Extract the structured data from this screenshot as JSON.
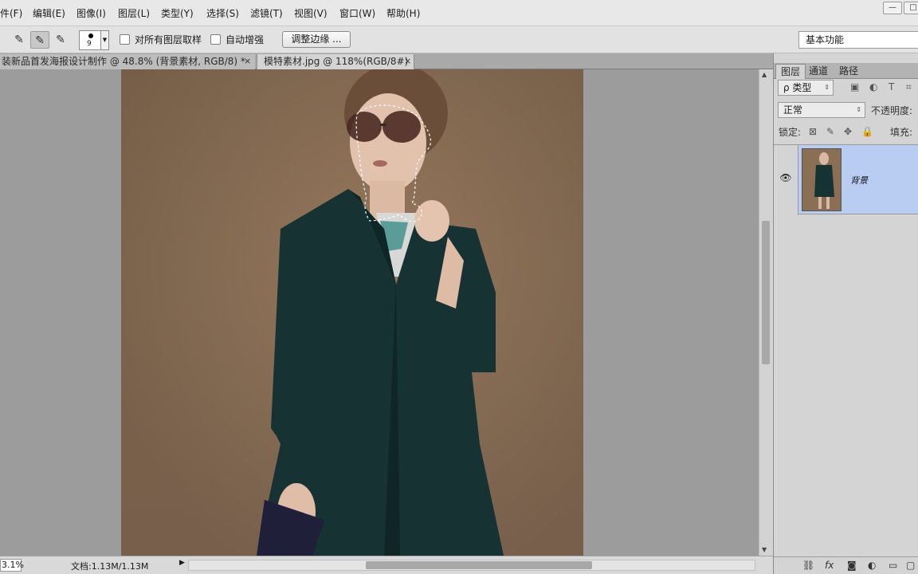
{
  "menu": [
    "件(F)",
    "编辑(E)",
    "图像(I)",
    "图层(L)",
    "类型(Y)",
    "选择(S)",
    "滤镜(T)",
    "视图(V)",
    "窗口(W)",
    "帮助(H)"
  ],
  "window_controls": {
    "minimize": "—",
    "restore": "□",
    "close": "✕"
  },
  "options": {
    "brush_size": "9",
    "sample_all_layers": "对所有图层取样",
    "auto_enhance": "自动增强",
    "refine_edge": "调整边缘 ...",
    "workspace": "基本功能"
  },
  "doc_tabs": [
    {
      "title": "装新品首发海报设计制作 @ 48.8% (背景素材, RGB/8) *",
      "close": "×"
    },
    {
      "title": "模特素材.jpg @ 118%(RGB/8#)",
      "close": "×"
    }
  ],
  "status": {
    "zoom": "3.1%",
    "doc_size": "文档:1.13M/1.13M"
  },
  "layers_panel": {
    "tabs": [
      "图层",
      "通道",
      "路径"
    ],
    "filter_kind": "ρ 类型",
    "blend_mode": "正常",
    "opacity_label": "不透明度:",
    "lock_label": "锁定:",
    "fill_label": "填充:",
    "layer_name": "背景"
  },
  "colors": {
    "accent_selection": "#b9cdf2",
    "backdrop": "#8a6f55",
    "coat": "#163233"
  }
}
